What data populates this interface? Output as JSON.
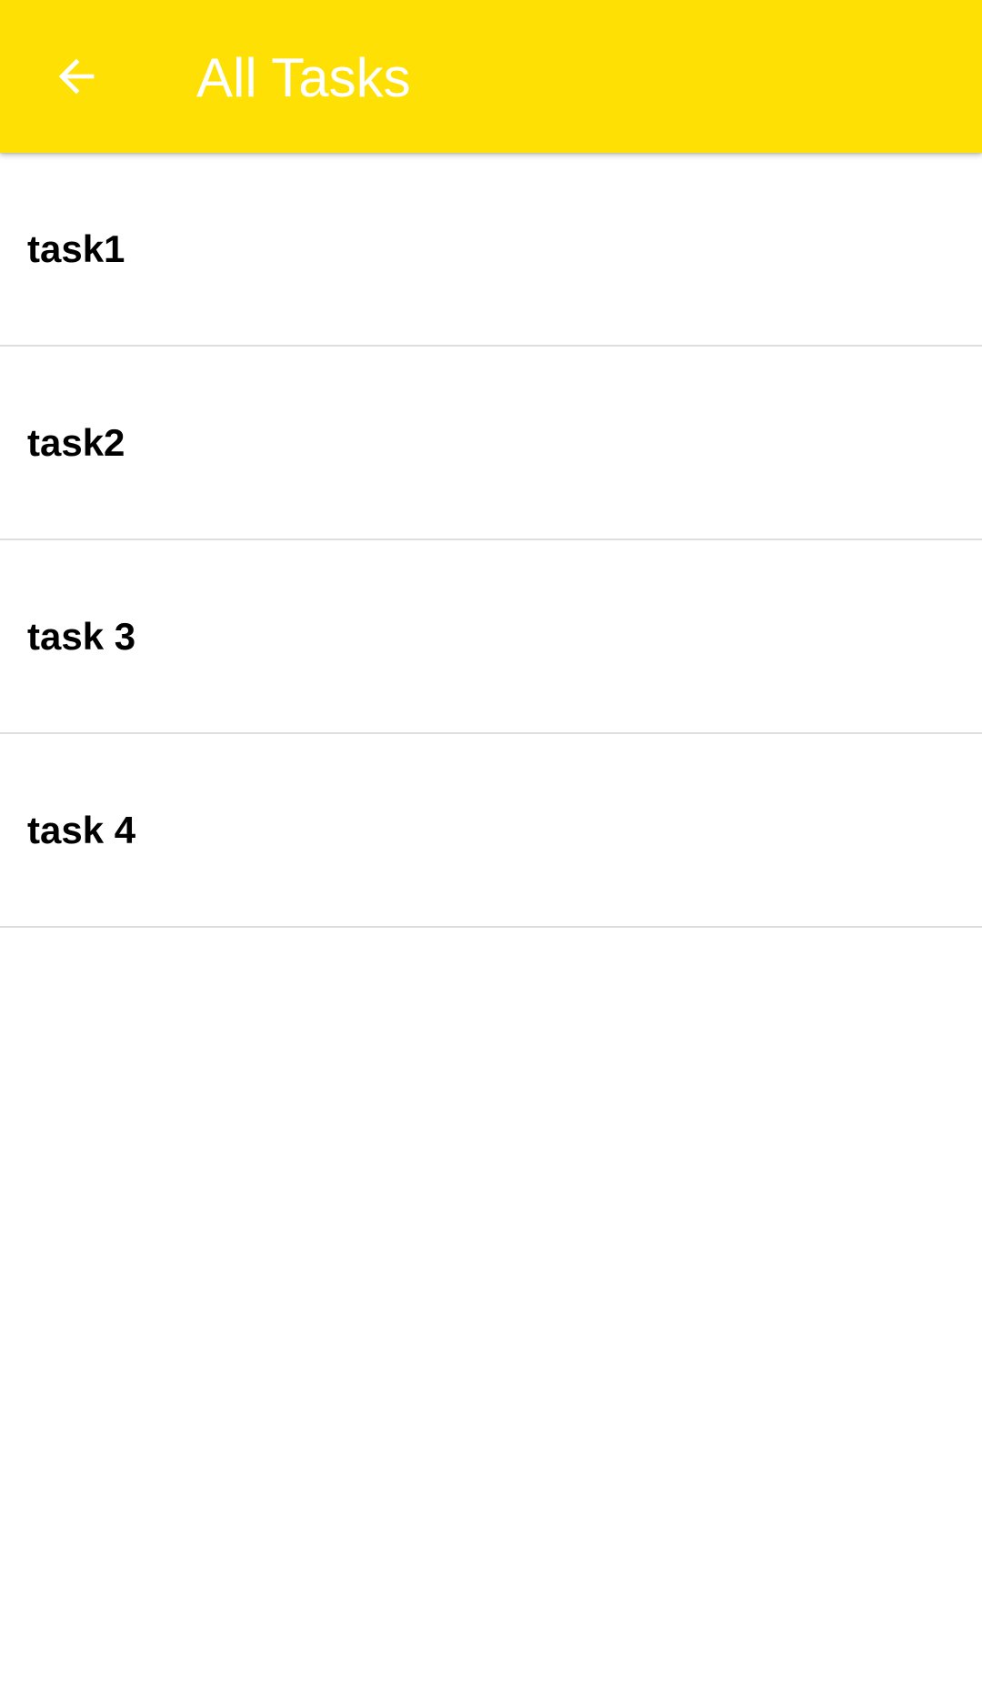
{
  "colors": {
    "app_bar_background": "#FFE004",
    "app_bar_text": "#FFFFFF",
    "divider": "#DEDEDE"
  },
  "app_bar": {
    "back_icon": "arrow-back-icon",
    "title": "All Tasks"
  },
  "tasks": [
    {
      "label": "task1"
    },
    {
      "label": "task2"
    },
    {
      "label": "task 3"
    },
    {
      "label": "task 4"
    }
  ]
}
